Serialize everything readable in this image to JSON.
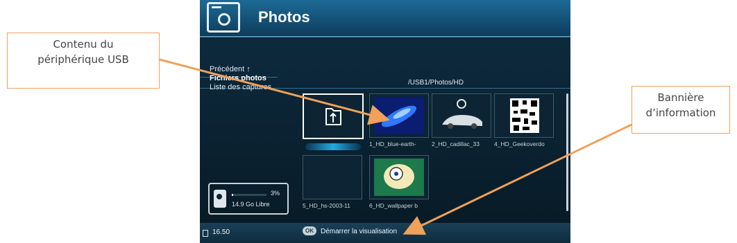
{
  "callouts": {
    "usb": {
      "line1": "Contenu du",
      "line2": "périphérique USB"
    },
    "banner": {
      "line1": "Bannière",
      "line2": "d’information"
    }
  },
  "header": {
    "title": "Photos",
    "icon": "camera-icon"
  },
  "menu": {
    "items": [
      {
        "label": "Précédent ↑"
      },
      {
        "label": "Fichiers photos"
      },
      {
        "label": "Liste des captures"
      }
    ]
  },
  "path": "/USB1/Photos/HD",
  "thumbnails": [
    {
      "caption": "",
      "icon": "folder-up-icon"
    },
    {
      "caption": "1_HD_blue-earth-",
      "icon": "blue-earth-image"
    },
    {
      "caption": "2_HD_cadillac_33",
      "icon": "cadillac-image"
    },
    {
      "caption": "4_HD_Geekoverdo",
      "icon": "qr-pattern-image"
    },
    {
      "caption": "5_HD_hs-2003-11",
      "icon": "dark-image"
    },
    {
      "caption": "6_HD_wallpaper b",
      "icon": "wallpaper-image"
    }
  ],
  "storage": {
    "percent_text": "3%",
    "percent": 0.03,
    "free": "14.9 Go Libre"
  },
  "footer": {
    "time": "16.50",
    "ok_label": "OK",
    "hint": "Démarrer la visualisation"
  },
  "colors": {
    "accent": "#f0a15a",
    "header": "#1d6a96",
    "screen_bg": "#0b2536"
  }
}
